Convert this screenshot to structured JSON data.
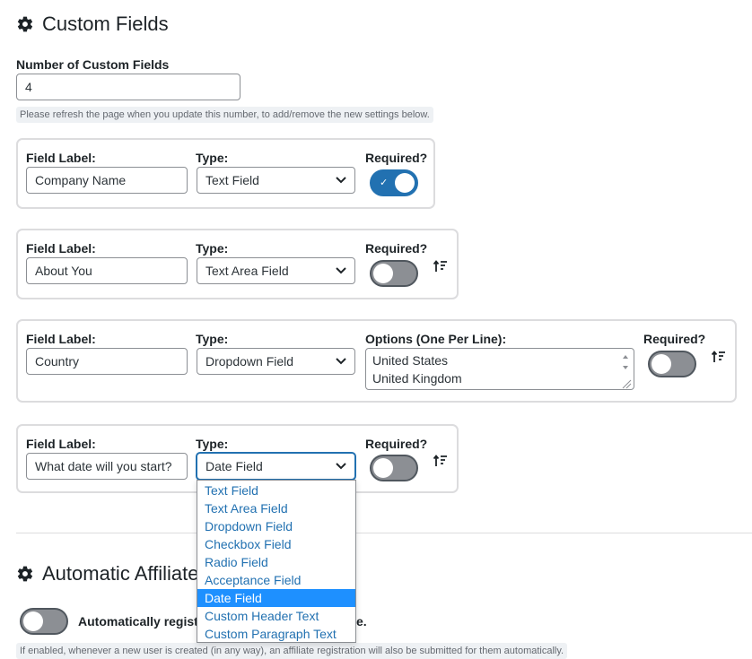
{
  "custom_fields": {
    "title": "Custom Fields",
    "title_icon": "gear-icon",
    "count_label": "Number of Custom Fields",
    "count_value": "4",
    "count_hint": "Please refresh the page when you update this number, to add/remove the new settings below."
  },
  "fields": [
    {
      "field_label_heading": "Field Label:",
      "field_label_value": "Company Name",
      "type_heading": "Type:",
      "type_value": "Text Field",
      "required_heading": "Required?",
      "required": true
    },
    {
      "field_label_heading": "Field Label:",
      "field_label_value": "About You",
      "type_heading": "Type:",
      "type_value": "Text Area Field",
      "required_heading": "Required?",
      "required": false
    },
    {
      "field_label_heading": "Field Label:",
      "field_label_value": "Country",
      "type_heading": "Type:",
      "type_value": "Dropdown Field",
      "options_heading": "Options (One Per Line):",
      "options": [
        "United States",
        "United Kingdom"
      ],
      "required_heading": "Required?",
      "required": false
    },
    {
      "field_label_heading": "Field Label:",
      "field_label_value": "What date will you start?",
      "type_heading": "Type:",
      "type_value": "Date Field",
      "required_heading": "Required?",
      "required": false
    }
  ],
  "type_dropdown": {
    "open": true,
    "options": [
      "Text Field",
      "Text Area Field",
      "Dropdown Field",
      "Checkbox Field",
      "Radio Field",
      "Acceptance Field",
      "Date Field",
      "Custom Header Text",
      "Custom Paragraph Text"
    ],
    "selected": "Date Field"
  },
  "auto_affiliate": {
    "title_visible": "Automatic Affiliate",
    "toggle_label_visible": "Automatically registe",
    "toggle_label_tail": "e.",
    "enabled": false,
    "hint_visible": "If enabled, whenever a new user is created (in any way), an affiliate registration will also be submitted for them automatically."
  },
  "colors": {
    "accent": "#2271b1",
    "selected_option": "#1e90ff",
    "toggle_off": "#8c8f94"
  }
}
